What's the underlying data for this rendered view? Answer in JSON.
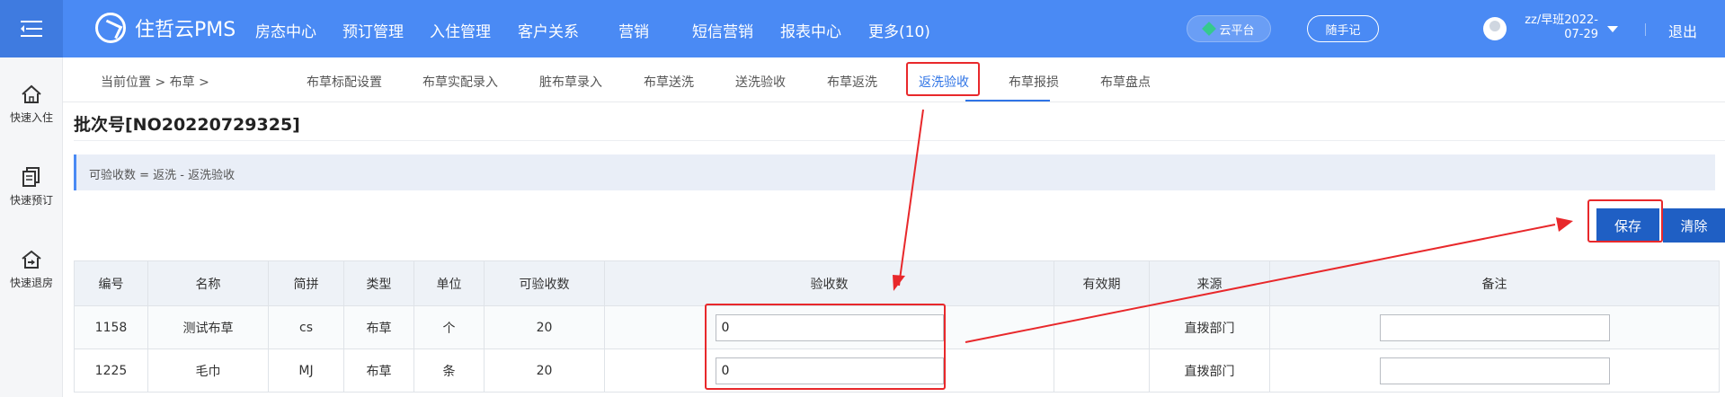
{
  "header": {
    "app_title": "住哲云PMS",
    "nav": [
      "房态中心",
      "预订管理",
      "入住管理",
      "客户关系",
      "营销",
      "短信营销",
      "报表中心",
      "更多(10)"
    ],
    "cloud_label": "云平台",
    "note_label": "随手记",
    "user_line1": "zz/早班2022-",
    "user_line2": "07-29",
    "logout_label": "退出"
  },
  "sidebar": {
    "items": [
      {
        "label": "快速入住",
        "icon": "home-icon"
      },
      {
        "label": "快速预订",
        "icon": "document-icon"
      },
      {
        "label": "快速退房",
        "icon": "checkout-icon"
      }
    ]
  },
  "subnav": {
    "breadcrumb": "当前位置 > 布草 >",
    "tabs": [
      "布草标配设置",
      "布草实配录入",
      "脏布草录入",
      "布草送洗",
      "送洗验收",
      "布草返洗",
      "返洗验收",
      "布草报损",
      "布草盘点"
    ],
    "active_tab": "返洗验收"
  },
  "batch_title": "批次号[NO20220729325]",
  "formula_note": "可验收数 = 返洗 - 返洗验收",
  "actions": {
    "save_label": "保存",
    "clear_label": "清除"
  },
  "table": {
    "headers": [
      "编号",
      "名称",
      "简拼",
      "类型",
      "单位",
      "可验收数",
      "验收数",
      "有效期",
      "来源",
      "备注"
    ],
    "rows": [
      {
        "id": "1158",
        "name": "测试布草",
        "pinyin": "cs",
        "type": "布草",
        "unit": "个",
        "available": "20",
        "accept": "0",
        "expiry": "",
        "source": "直拨部门",
        "remark": ""
      },
      {
        "id": "1225",
        "name": "毛巾",
        "pinyin": "MJ",
        "type": "布草",
        "unit": "条",
        "available": "20",
        "accept": "0",
        "expiry": "",
        "source": "直拨部门",
        "remark": ""
      }
    ]
  },
  "colors": {
    "topbar": "#4a8af4",
    "accent": "#2f74e6",
    "button": "#1f5fc4",
    "annotation": "#e8282b"
  }
}
